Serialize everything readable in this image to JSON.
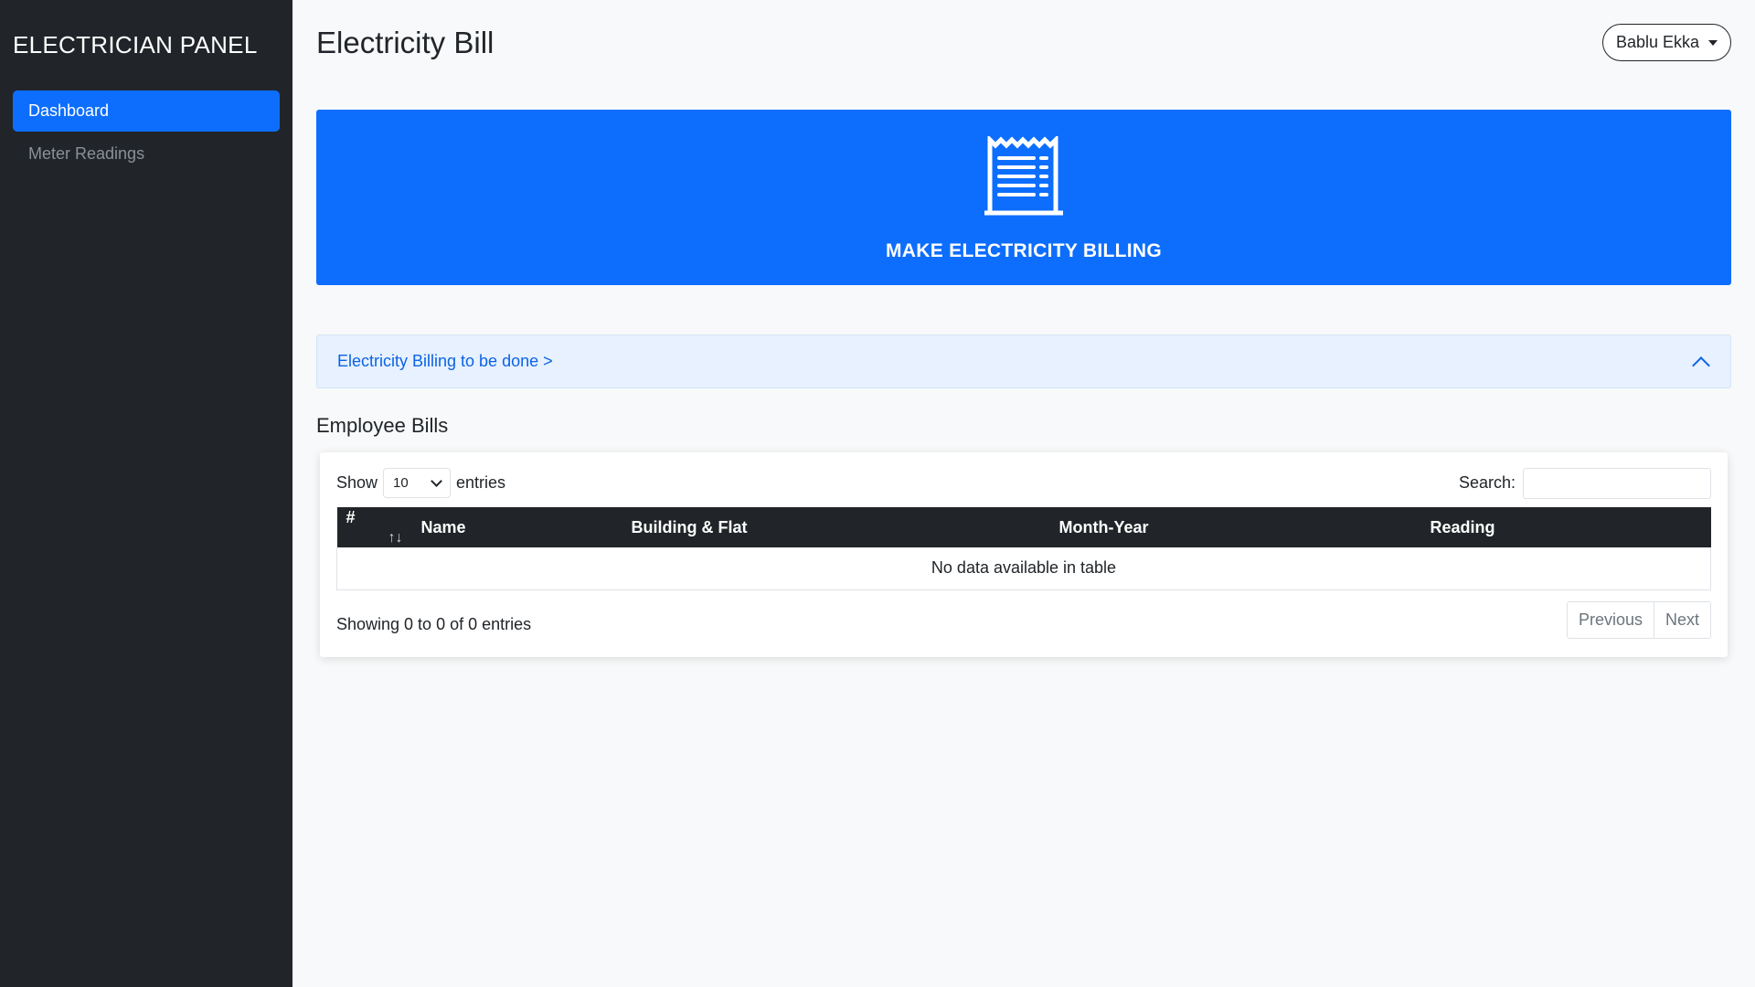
{
  "sidebar": {
    "brand": "ELECTRICIAN PANEL",
    "items": [
      {
        "label": "Dashboard",
        "active": true
      },
      {
        "label": "Meter Readings",
        "active": false
      }
    ]
  },
  "header": {
    "title": "Electricity Bill",
    "user_name": "Bablu Ekka"
  },
  "banner": {
    "label": "MAKE ELECTRICITY BILLING",
    "icon": "receipt-icon",
    "color": "#0d6efd"
  },
  "accordion": {
    "label": "Electricity Billing to be done >"
  },
  "employee_bills": {
    "title": "Employee Bills",
    "show_label": "Show",
    "entries_label": "entries",
    "page_length": "10",
    "search_label": "Search:",
    "search_value": "",
    "columns": [
      "#",
      "Name",
      "Building & Flat",
      "Month-Year",
      "Reading"
    ],
    "sort_icon": "↑↓",
    "empty_message": "No data available in table",
    "info": "Showing 0 to 0 of 0 entries",
    "previous_label": "Previous",
    "next_label": "Next"
  }
}
